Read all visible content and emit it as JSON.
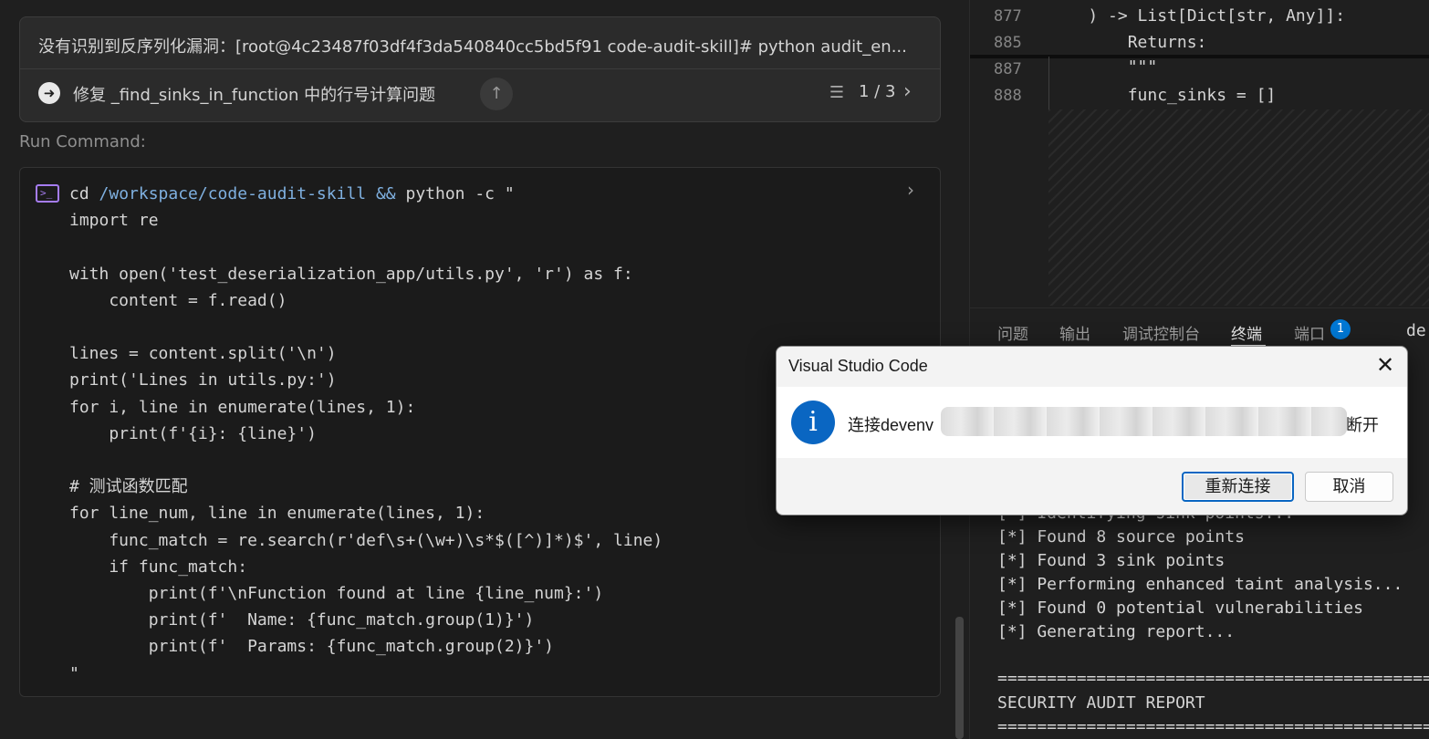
{
  "chat": {
    "task_title": "没有识别到反序列化漏洞：[root@4c23487f03df4f3da540840cc5bd5f91 code-audit-skill]# python audit_en...",
    "subtask_label": "修复 _find_sinks_in_function 中的行号计算问题",
    "pager": "1 / 3",
    "run_command_label": "Run Command:",
    "command": {
      "first_line": {
        "cd": "cd ",
        "path": "/workspace/code-audit-skill",
        "op": " && ",
        "rest": "python -c \""
      },
      "body": "import re\n\nwith open('test_deserialization_app/utils.py', 'r') as f:\n    content = f.read()\n\nlines = content.split('\\n')\nprint('Lines in utils.py:')\nfor i, line in enumerate(lines, 1):\n    print(f'{i}: {line}')\n\n# 测试函数匹配\nfor line_num, line in enumerate(lines, 1):\n    func_match = re.search(r'def\\s+(\\w+)\\s*$([^)]*)$', line)\n    if func_match:\n        print(f'\\nFunction found at line {line_num}:')\n        print(f'  Name: {func_match.group(1)}')\n        print(f'  Params: {func_match.group(2)}')\n\""
    }
  },
  "editor": {
    "lines": [
      {
        "num": "877",
        "code": "    ) -> List[Dict[str, Any]]:"
      },
      {
        "num": "885",
        "code": "        Returns:"
      },
      {
        "num": "887",
        "code": "        \"\"\""
      },
      {
        "num": "888",
        "code": "        func_sinks = []"
      }
    ]
  },
  "panel": {
    "tabs": [
      "问题",
      "输出",
      "调试控制台",
      "终端",
      "端口"
    ],
    "active_tab": "终端",
    "ports_badge": "1",
    "fragment": "de"
  },
  "terminal": {
    "partial_line": "[*] Identifying sink points...",
    "lines": [
      "[*] Found 8 source points",
      "[*] Found 3 sink points",
      "[*] Performing enhanced taint analysis...",
      "[*] Found 0 potential vulnerabilities",
      "[*] Generating report..."
    ],
    "rule": "============================================================",
    "report_title": "SECURITY AUDIT REPORT"
  },
  "dialog": {
    "title": "Visual Studio Code",
    "message_prefix": "连接devenv",
    "message_suffix": "断开",
    "reconnect_label": "重新连接",
    "cancel_label": "取消"
  },
  "colors": {
    "accent": "#0078d4",
    "terminal_icon": "#a57cf0",
    "background": "#1f1f1f"
  }
}
